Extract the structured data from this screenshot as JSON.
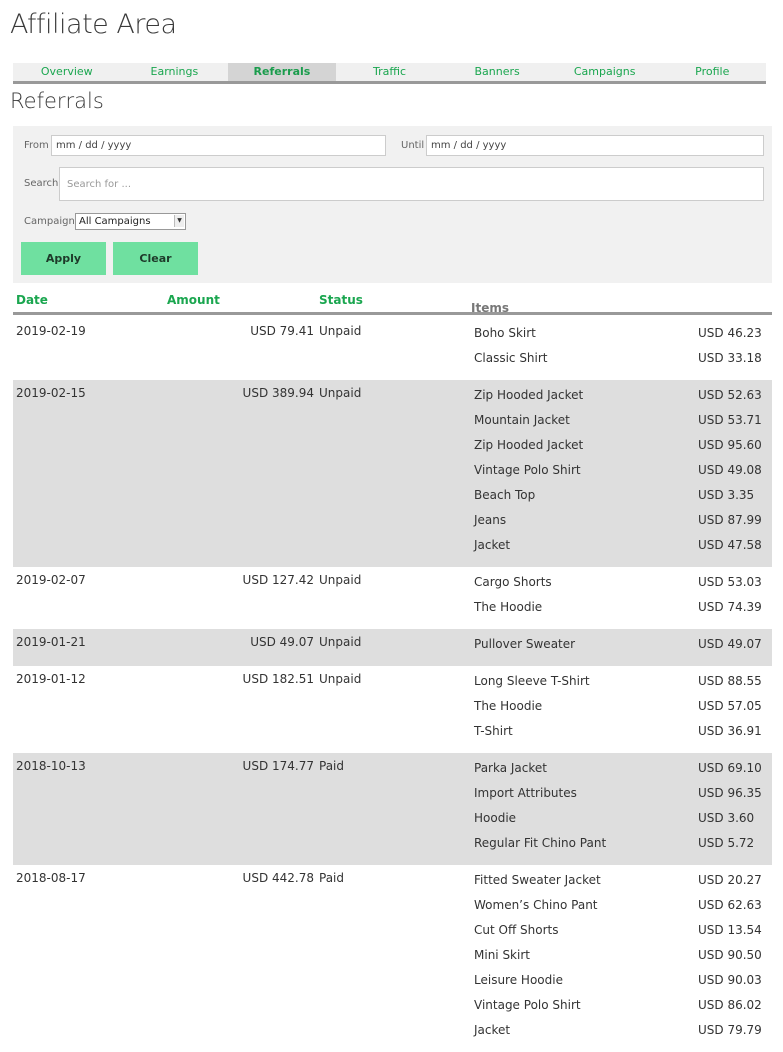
{
  "page": {
    "title": "Affiliate Area"
  },
  "tabs": [
    {
      "label": "Overview",
      "active": false
    },
    {
      "label": "Earnings",
      "active": false
    },
    {
      "label": "Referrals",
      "active": true
    },
    {
      "label": "Traffic",
      "active": false
    },
    {
      "label": "Banners",
      "active": false
    },
    {
      "label": "Campaigns",
      "active": false
    },
    {
      "label": "Profile",
      "active": false
    }
  ],
  "section": {
    "title": "Referrals"
  },
  "filters": {
    "from_label": "From",
    "from_value": "mm / dd / yyyy",
    "until_label": "Until",
    "until_value": "mm / dd / yyyy",
    "search_label": "Search",
    "search_placeholder": "Search for ...",
    "campaign_label": "Campaign",
    "campaign_value": "All Campaigns",
    "apply_label": "Apply",
    "clear_label": "Clear"
  },
  "table": {
    "headers": {
      "date": "Date",
      "amount": "Amount",
      "status": "Status",
      "items": "Items"
    },
    "rows": [
      {
        "date": "2019-02-19",
        "amount": "USD 79.41",
        "status": "Unpaid",
        "shaded": false,
        "items": [
          {
            "name": "Boho Skirt",
            "price": "USD 46.23"
          },
          {
            "name": "Classic Shirt",
            "price": "USD 33.18"
          }
        ]
      },
      {
        "date": "2019-02-15",
        "amount": "USD 389.94",
        "status": "Unpaid",
        "shaded": true,
        "items": [
          {
            "name": "Zip Hooded Jacket",
            "price": "USD 52.63"
          },
          {
            "name": "Mountain Jacket",
            "price": "USD 53.71"
          },
          {
            "name": "Zip Hooded Jacket",
            "price": "USD 95.60"
          },
          {
            "name": "Vintage Polo Shirt",
            "price": "USD 49.08"
          },
          {
            "name": "Beach Top",
            "price": "USD 3.35"
          },
          {
            "name": "Jeans",
            "price": "USD 87.99"
          },
          {
            "name": "Jacket",
            "price": "USD 47.58"
          }
        ]
      },
      {
        "date": "2019-02-07",
        "amount": "USD 127.42",
        "status": "Unpaid",
        "shaded": false,
        "items": [
          {
            "name": "Cargo Shorts",
            "price": "USD 53.03"
          },
          {
            "name": "The Hoodie",
            "price": "USD 74.39"
          }
        ]
      },
      {
        "date": "2019-01-21",
        "amount": "USD 49.07",
        "status": "Unpaid",
        "shaded": true,
        "items": [
          {
            "name": "Pullover Sweater",
            "price": "USD 49.07"
          }
        ]
      },
      {
        "date": "2019-01-12",
        "amount": "USD 182.51",
        "status": "Unpaid",
        "shaded": false,
        "items": [
          {
            "name": "Long Sleeve T-Shirt",
            "price": "USD 88.55"
          },
          {
            "name": "The Hoodie",
            "price": "USD 57.05"
          },
          {
            "name": "T-Shirt",
            "price": "USD 36.91"
          }
        ]
      },
      {
        "date": "2018-10-13",
        "amount": "USD 174.77",
        "status": "Paid",
        "shaded": true,
        "items": [
          {
            "name": "Parka Jacket",
            "price": "USD 69.10"
          },
          {
            "name": "Import Attributes",
            "price": "USD 96.35"
          },
          {
            "name": "Hoodie",
            "price": "USD 3.60"
          },
          {
            "name": "Regular Fit Chino Pant",
            "price": "USD 5.72"
          }
        ]
      },
      {
        "date": "2018-08-17",
        "amount": "USD 442.78",
        "status": "Paid",
        "shaded": false,
        "items": [
          {
            "name": "Fitted Sweater Jacket",
            "price": "USD 20.27"
          },
          {
            "name": "Women’s Chino Pant",
            "price": "USD 62.63"
          },
          {
            "name": "Cut Off Shorts",
            "price": "USD 13.54"
          },
          {
            "name": "Mini Skirt",
            "price": "USD 90.50"
          },
          {
            "name": "Leisure Hoodie",
            "price": "USD 90.03"
          },
          {
            "name": "Vintage Polo Shirt",
            "price": "USD 86.02"
          },
          {
            "name": "Jacket",
            "price": "USD 79.79"
          }
        ]
      }
    ]
  }
}
